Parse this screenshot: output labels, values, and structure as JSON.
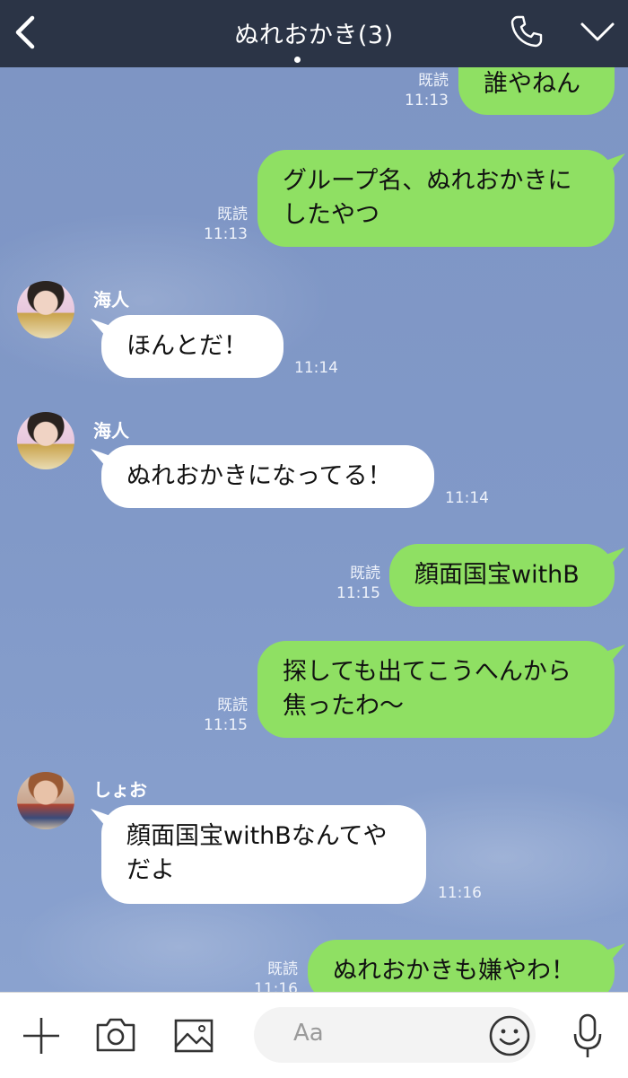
{
  "header": {
    "title": "ぬれおかき(3)",
    "icons": [
      "back-chevron-icon",
      "phone-icon",
      "chevron-down-icon"
    ]
  },
  "messages": [
    {
      "side": "right",
      "read": "既読",
      "time": "11:13",
      "lines": [
        "誰やねん"
      ]
    },
    {
      "side": "right",
      "read": "既読",
      "time": "11:13",
      "lines": [
        "グループ名、ぬれおかきに",
        "したやつ"
      ]
    },
    {
      "side": "left",
      "sender": "海人",
      "time": "11:14",
      "lines": [
        "ほんとだ！"
      ]
    },
    {
      "side": "left",
      "sender": "海人",
      "time": "11:14",
      "lines": [
        "ぬれおかきになってる！"
      ]
    },
    {
      "side": "right",
      "read": "既読",
      "time": "11:15",
      "lines": [
        "顔面国宝withB"
      ]
    },
    {
      "side": "right",
      "read": "既読",
      "time": "11:15",
      "lines": [
        "探しても出てこうへんから",
        "焦ったわ〜"
      ]
    },
    {
      "side": "left",
      "sender": "しょお",
      "time": "11:16",
      "lines": [
        "顔面国宝withBなんてや",
        "だよ"
      ]
    },
    {
      "side": "right",
      "read": "既読",
      "time": "11:16",
      "lines": [
        "ぬれおかきも嫌やわ！"
      ]
    }
  ],
  "footer": {
    "input_placeholder": "Aa",
    "icons": [
      "plus-icon",
      "camera-icon",
      "image-icon",
      "emoji-icon",
      "microphone-icon"
    ]
  },
  "colors": {
    "header_bg": "#2b3446",
    "chat_bg": "#7f97c6",
    "sent_bubble": "#8fe063",
    "received_bubble": "#ffffff"
  }
}
